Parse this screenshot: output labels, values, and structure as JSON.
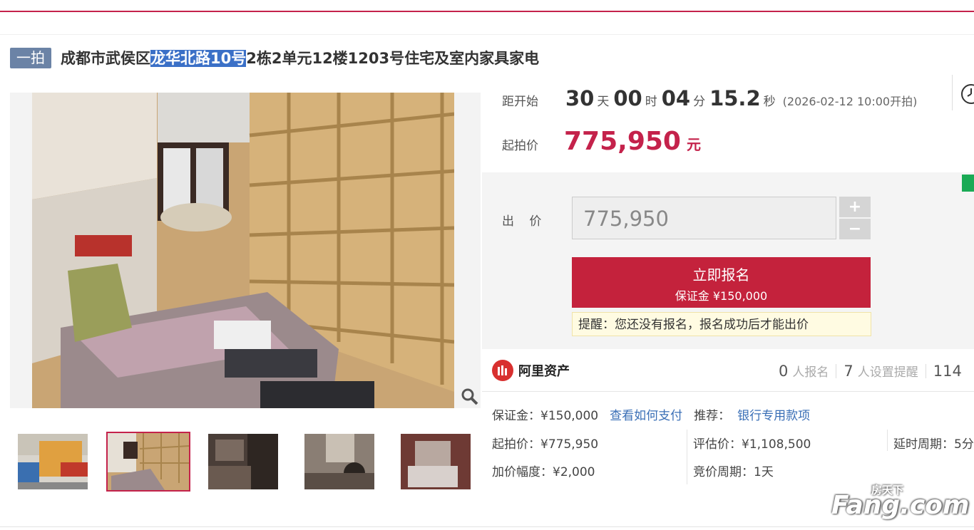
{
  "listing": {
    "badge": "一拍",
    "title_pre": "成都市武侯区",
    "title_highlight": "龙华北路10号",
    "title_post": "2栋2单元12楼1203号住宅及室内家具家电"
  },
  "countdown": {
    "label": "距开始",
    "days": "30",
    "days_unit": "天",
    "hours": "00",
    "hours_unit": "时",
    "minutes": "04",
    "minutes_unit": "分",
    "seconds": "15.2",
    "seconds_unit": "秒",
    "start_note": "(2026-02-12 10:00开拍)"
  },
  "start_price": {
    "label": "起拍价",
    "value": "775,950",
    "unit": "元"
  },
  "bid": {
    "label": "出 价",
    "value": "775,950",
    "plus": "+",
    "minus": "−"
  },
  "signup": {
    "title": "立即报名",
    "deposit": "保证金 ¥150,000"
  },
  "reminder": "提醒：您还没有报名，报名成功后才能出价",
  "platform": {
    "name": "阿里资产"
  },
  "stats": {
    "registered_count": "0",
    "registered_label": "人报名",
    "reminder_count": "7",
    "reminder_label": "人设置提醒",
    "views_count": "114"
  },
  "details": {
    "deposit": "保证金：¥150,000",
    "pay_link": "查看如何支付",
    "recommend_label": "推荐：",
    "recommend_link": "银行专用款项",
    "start_price": "起拍价：¥775,950",
    "appraisal": "评估价：¥1,108,500",
    "delay": "延时周期：5分",
    "increment": "加价幅度：¥2,000",
    "cycle": "竞价周期：1天"
  },
  "watermark": {
    "small": "房天下",
    "big": "Fang.com"
  },
  "colors": {
    "accent": "#c4224b",
    "badge": "#6b83a6",
    "link": "#3a6fb6"
  }
}
